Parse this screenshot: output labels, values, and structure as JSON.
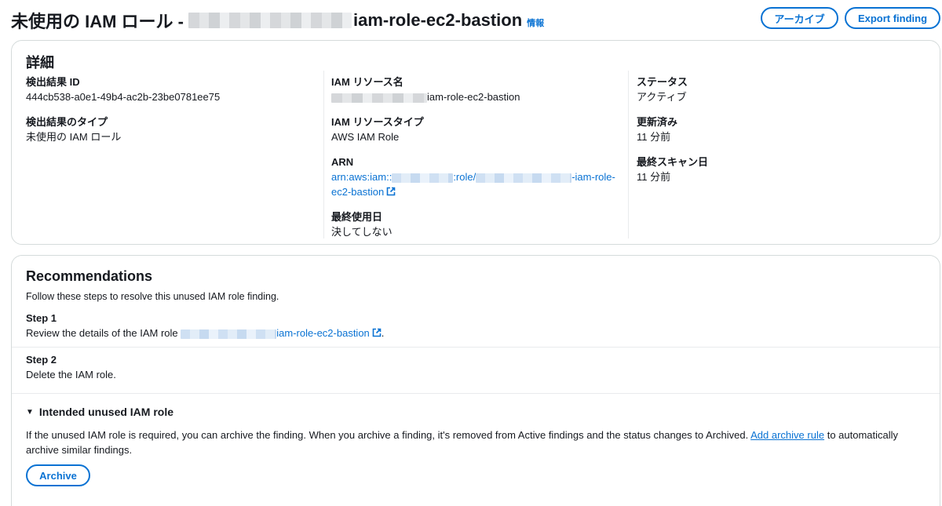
{
  "header": {
    "title_prefix": "未使用の IAM ロール -",
    "title_suffix": "iam-role-ec2-bastion",
    "info_label": "情報",
    "archive_button": "アーカイブ",
    "export_button": "Export finding"
  },
  "details": {
    "heading": "詳細",
    "finding_id": {
      "label": "検出結果 ID",
      "value": "444cb538-a0e1-49b4-ac2b-23be0781ee75"
    },
    "finding_type": {
      "label": "検出結果のタイプ",
      "value": "未使用の IAM ロール"
    },
    "resource_name": {
      "label": "IAM リソース名",
      "value_suffix": "iam-role-ec2-bastion"
    },
    "resource_type": {
      "label": "IAM リソースタイプ",
      "value": "AWS IAM Role"
    },
    "arn": {
      "label": "ARN",
      "part1": "arn:aws:iam::",
      "part2": ":role/",
      "part3": "-iam-role-",
      "part4": "ec2-bastion"
    },
    "last_used": {
      "label": "最終使用日",
      "value": "決してしない"
    },
    "status": {
      "label": "ステータス",
      "value": "アクティブ"
    },
    "updated": {
      "label": "更新済み",
      "value": "11 分前"
    },
    "last_scan": {
      "label": "最終スキャン日",
      "value": "11 分前"
    }
  },
  "recommendations": {
    "heading": "Recommendations",
    "description": "Follow these steps to resolve this unused IAM role finding.",
    "step1": {
      "label": "Step 1",
      "text_prefix": "Review the details of the IAM role",
      "link_suffix": "iam-role-ec2-bastion",
      "text_end": "."
    },
    "step2": {
      "label": "Step 2",
      "text": "Delete the IAM role."
    },
    "expander": {
      "caret": "▼",
      "title": "Intended unused IAM role",
      "text_before": "If the unused IAM role is required, you can archive the finding. When you archive a finding, it's removed from Active findings and the status changes to Archived.",
      "link": "Add archive rule",
      "text_after": "to automatically archive similar findings.",
      "archive_button": "Archive"
    }
  },
  "colors": {
    "accent": "#0972d3",
    "text": "#16191f",
    "border": "#d5dbdb"
  }
}
